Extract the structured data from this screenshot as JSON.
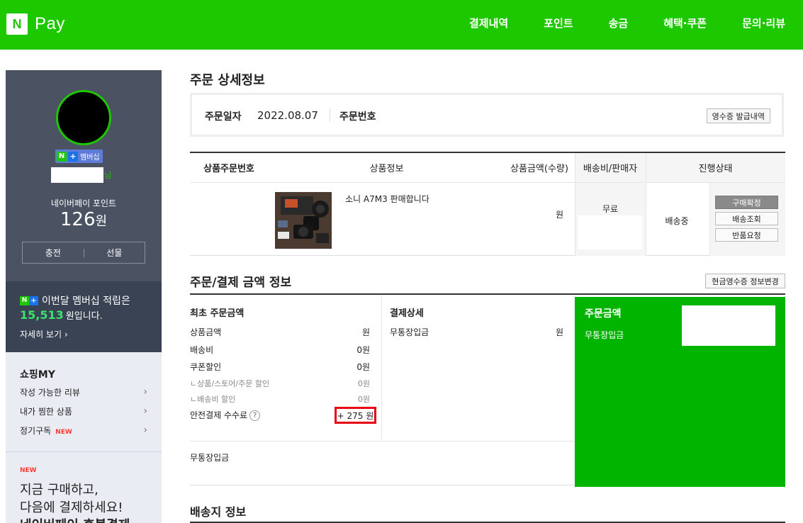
{
  "header": {
    "logo_mark": "N",
    "logo_text": "Pay",
    "nav": [
      "결제내역",
      "포인트",
      "송금",
      "혜택·쿠폰",
      "문의·리뷰"
    ]
  },
  "sidebar": {
    "membership_badge": "멤버십",
    "username_suffix": "님",
    "point_label": "네이버페이 포인트",
    "point_value": "126",
    "point_unit": "원",
    "charge_label": "충전",
    "gift_label": "선물",
    "promo": {
      "line1": "이번달 멤버십 적립은",
      "amount": "15,513",
      "line2_suffix": "원입니다.",
      "more": "자세히 보기"
    },
    "shop_title": "쇼핑MY",
    "shop_items": [
      "작성 가능한 리뷰",
      "내가 찜한 상품",
      "정기구독"
    ],
    "new_tag": "NEW",
    "bnpl_new": "NEW",
    "bnpl_line1": "지금 구매하고,",
    "bnpl_line2": "다음에 결제하세요!",
    "bnpl_line3": "네이버페이 후불결제"
  },
  "order": {
    "page_title": "주문 상세정보",
    "date_label": "주문일자",
    "date_value": "2022.08.07",
    "number_label": "주문번호",
    "receipt_button": "영수증 발급내역"
  },
  "product_table": {
    "headers": [
      "상품주문번호",
      "상품정보",
      "상품금액(수량)",
      "배송비/판매자",
      "진행상태"
    ],
    "product_name": "소니 A7M3 판매합니다",
    "price_unit": "원",
    "shipping": "무료",
    "status": "배송중",
    "buttons": [
      "구매확정",
      "배송조회",
      "반품요청"
    ]
  },
  "payment": {
    "title": "주문/결제 금액 정보",
    "cash_receipt_button": "현금영수증 정보변경",
    "initial_title": "최초 주문금액",
    "rows": [
      {
        "label": "상품금액",
        "value": "원"
      },
      {
        "label": "배송비",
        "value": "0원"
      },
      {
        "label": "쿠폰할인",
        "value": "0원"
      },
      {
        "label": "ㄴ상품/스토어/주문 할인",
        "value": "0원"
      },
      {
        "label": "ㄴ배송비 할인",
        "value": "0원"
      }
    ],
    "fee_label": "안전결제 수수료",
    "fee_value": "+ 275 원",
    "detail_title": "결제상세",
    "detail_label": "무통장입금",
    "detail_value": "원",
    "bottom_method": "무통장입금",
    "panel_title": "주문금액",
    "panel_sub": "무통장입금"
  },
  "shipping": {
    "title": "배송지 정보"
  },
  "colors": {
    "brand_green": "#1ec800",
    "panel_green": "#00b400",
    "highlight_red": "#e60012"
  }
}
